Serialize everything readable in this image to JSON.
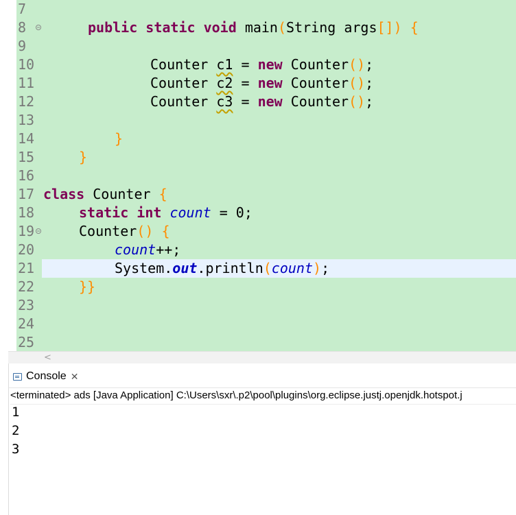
{
  "editor": {
    "line_numbers": [
      "7",
      "8",
      "9",
      "10",
      "11",
      "12",
      "13",
      "14",
      "15",
      "16",
      "17",
      "18",
      "19",
      "20",
      "21",
      "22",
      "23",
      "24",
      "25"
    ],
    "main_sig": {
      "public": "public",
      "static": "static",
      "void": "void",
      "name": "main",
      "open": "(",
      "type": "String",
      "arg": "args",
      "arr": "[]",
      "close": ")",
      "brace": "{"
    },
    "new_lines": [
      {
        "type": "Counter",
        "var": "c1",
        "eq": "=",
        "new": "new",
        "ctor": "Counter",
        "parens": "()",
        "semi": ";"
      },
      {
        "type": "Counter",
        "var": "c2",
        "eq": "=",
        "new": "new",
        "ctor": "Counter",
        "parens": "()",
        "semi": ";"
      },
      {
        "type": "Counter",
        "var": "c3",
        "eq": "=",
        "new": "new",
        "ctor": "Counter",
        "parens": "()",
        "semi": ";"
      }
    ],
    "close_brace_inner": "}",
    "close_brace_outer": "}",
    "class_decl": {
      "kw": "class",
      "name": "Counter",
      "brace": "{"
    },
    "field_decl": {
      "static": "static",
      "int": "int",
      "name": "count",
      "rest": " = 0;"
    },
    "ctor_decl": {
      "name": "Counter",
      "parens": "()",
      "brace": "{"
    },
    "incr": {
      "name": "count",
      "op": "++;"
    },
    "println": {
      "sys": "System.",
      "out": "out",
      "call": ".println",
      "open": "(",
      "arg": "count",
      "close": ")",
      "semi": ";"
    },
    "ctor_close": "}}"
  },
  "console": {
    "tab_label": "Console",
    "close_glyph": "✕",
    "status": "<terminated> ads [Java Application] C:\\Users\\sxr\\.p2\\pool\\plugins\\org.eclipse.justj.openjdk.hotspot.j",
    "output": [
      "1",
      "2",
      "3"
    ]
  },
  "scroll_left_glyph": "<",
  "colors": {
    "editor_bg": "#c7edcc",
    "current_line": "#e8f2fe",
    "keyword": "#7f0055",
    "field": "#0000c0",
    "bracket": "#ff8c00"
  },
  "icons": {
    "warning": "warning-icon",
    "fold": "fold-toggle-icon",
    "console": "console-icon"
  }
}
